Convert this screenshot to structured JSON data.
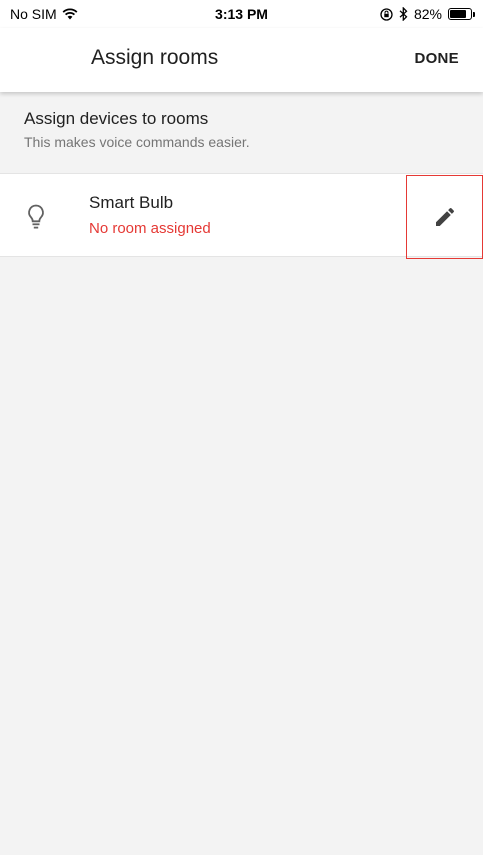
{
  "status_bar": {
    "carrier": "No SIM",
    "time": "3:13 PM",
    "battery_percent": "82%",
    "battery_level": 0.82,
    "icons": [
      "wifi-icon",
      "orientation-lock-icon",
      "bluetooth-icon",
      "battery-icon"
    ]
  },
  "app_bar": {
    "title": "Assign rooms",
    "done_label": "DONE"
  },
  "section": {
    "title": "Assign devices to rooms",
    "subtitle": "This makes voice commands easier."
  },
  "devices": [
    {
      "name": "Smart Bulb",
      "status": "No room assigned",
      "icon": "lightbulb-icon",
      "action_icon": "edit-pencil-icon"
    }
  ],
  "colors": {
    "background": "#f3f3f3",
    "surface": "#ffffff",
    "alert_red": "#e53935",
    "text_primary": "#212121",
    "text_secondary": "#757575",
    "icon_gray": "#616161"
  }
}
